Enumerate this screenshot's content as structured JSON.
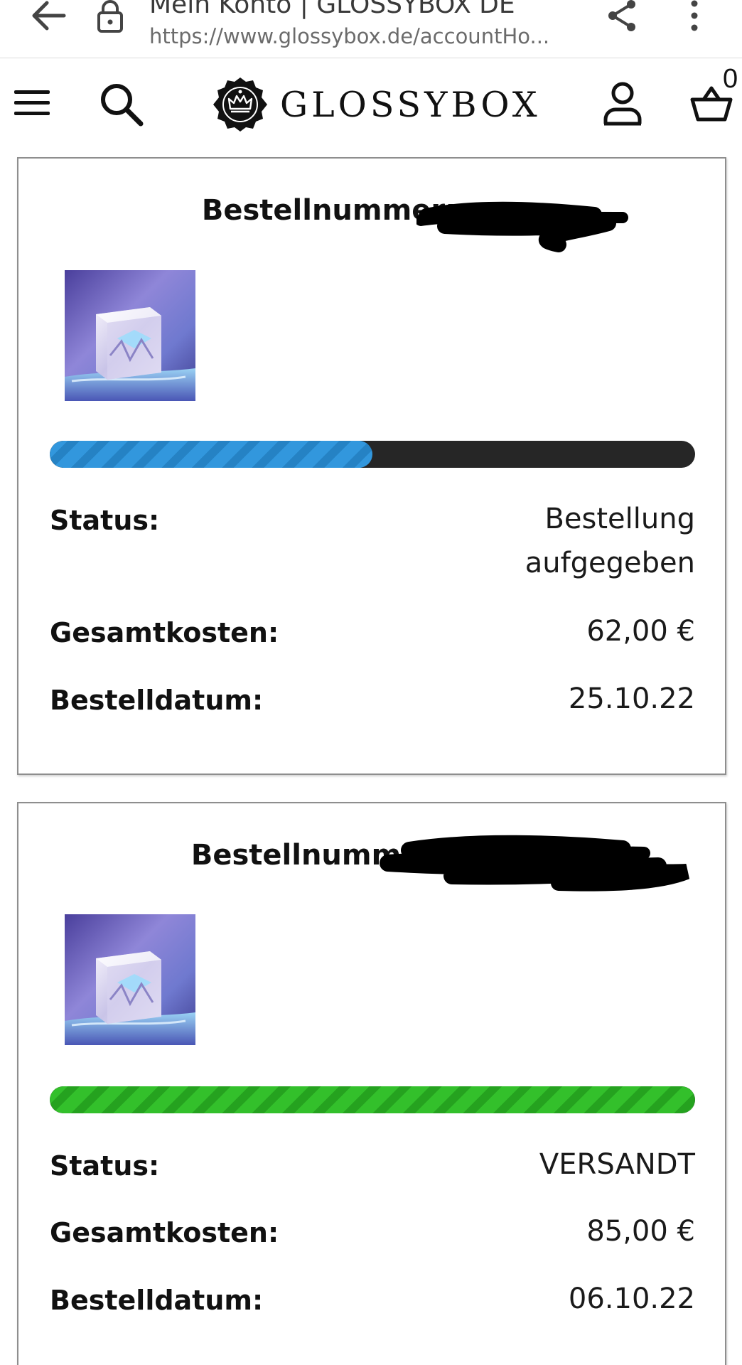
{
  "browser": {
    "tab_title": "Mein Konto | GLOSSYBOX DE",
    "url": "https://www.glossybox.de/accountHo..."
  },
  "header": {
    "logo_text": "GLOSSYBOX",
    "basket_count": "0"
  },
  "orders": [
    {
      "number_label": "Bestellnummer:",
      "progress_percent": 50,
      "progress_color": "#3297dd",
      "status_label": "Status:",
      "status_value": "Bestellung\naufgegeben",
      "total_label": "Gesamtkosten:",
      "total_value": "62,00 €",
      "date_label": "Bestelldatum:",
      "date_value": "25.10.22"
    },
    {
      "number_label": "Bestellnummer:",
      "progress_percent": 100,
      "progress_color": "#33c02b",
      "status_label": "Status:",
      "status_value": "VERSANDT",
      "total_label": "Gesamtkosten:",
      "total_value": "85,00 €",
      "date_label": "Bestelldatum:",
      "date_value": "06.10.22"
    }
  ],
  "icons": {
    "back": "arrow-left-icon",
    "lock": "lock-icon",
    "share": "share-icon",
    "more": "more-vertical-icon",
    "menu": "hamburger-menu-icon",
    "search": "search-icon",
    "account": "user-icon",
    "basket": "basket-icon"
  }
}
